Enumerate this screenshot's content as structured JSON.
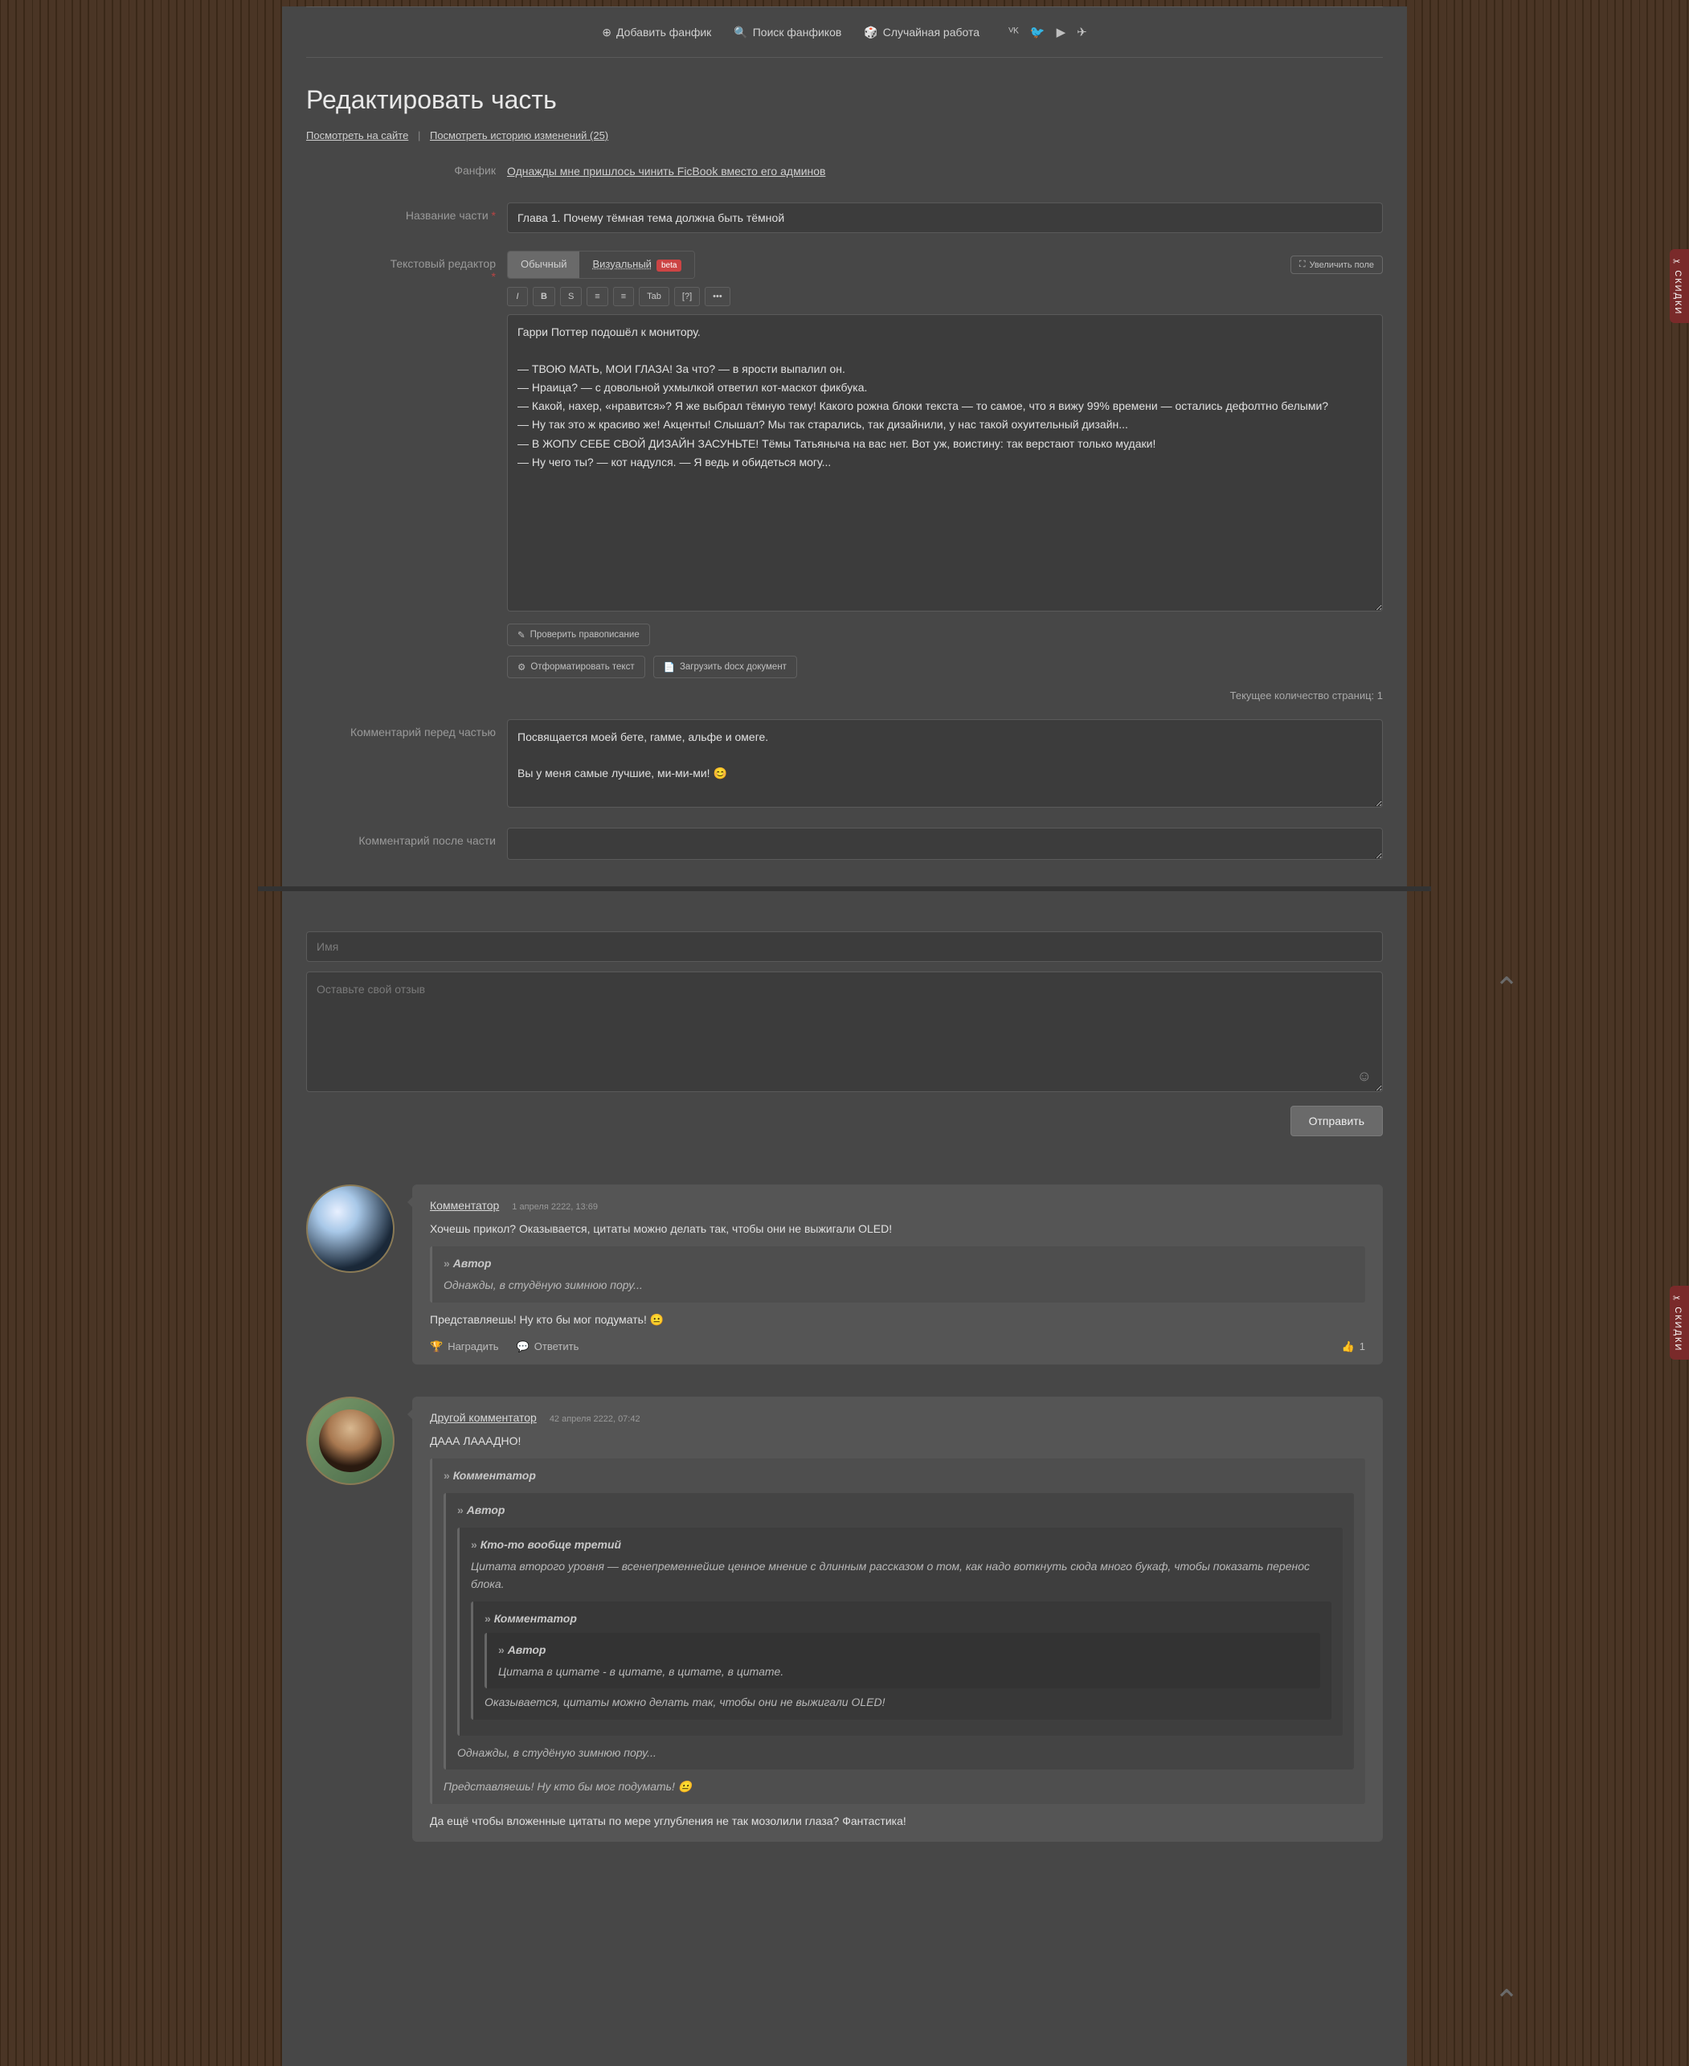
{
  "nav": {
    "add": "Добавить фанфик",
    "search": "Поиск фанфиков",
    "random": "Случайная работа"
  },
  "page_title": "Редактировать часть",
  "sub": {
    "view": "Посмотреть на сайте",
    "history": "Посмотреть историю изменений (25)"
  },
  "labels": {
    "fanfic": "Фанфик",
    "chapter_title": "Название части",
    "editor": "Текстовый редактор",
    "comment_before": "Комментарий перед частью",
    "comment_after": "Комментарий после части"
  },
  "fanfic_link": "Однажды мне пришлось чинить FicBook вместо его админов",
  "chapter_title_value": "Глава 1. Почему тёмная тема должна быть тёмной",
  "editor_tabs": {
    "plain": "Обычный",
    "visual": "Визуальный",
    "beta": "beta"
  },
  "expand": "Увеличить поле",
  "toolbar": {
    "i": "I",
    "b": "B",
    "s": "S",
    "al": "≡",
    "ac": "≡",
    "tab": "Tab",
    "q": "[?]",
    "more": "•••"
  },
  "editor_text": "Гарри Поттер подошёл к монитору.\n\n— ТВОЮ МАТЬ, МОИ ГЛАЗА! За что? — в ярости выпалил он.\n— Нраица? — с довольной ухмылкой ответил кот-маскот фикбука.\n— Какой, нахер, «нравится»? Я же выбрал тёмную тему! Какого рожна блоки текста — то самое, что я вижу 99% времени — остались дефолтно белыми?\n— Ну так это ж красиво же! Акценты! Слышал? Мы так старались, так дизайнили, у нас такой охуительный дизайн...\n— В ЖОПУ СЕБЕ СВОЙ ДИЗАЙН ЗАСУНЬТЕ! Тёмы Татьяныча на вас нет. Вот уж, воистину: так верстают только мудаки!\n— Ну чего ты? — кот надулся. — Я ведь и обидеться могу...",
  "under": {
    "spell": "Проверить правописание",
    "format": "Отформатировать текст",
    "docx": "Загрузить docx документ"
  },
  "pagecount": "Текущее количество страниц: 1",
  "comment_before_value": "Посвящается моей бете, гамме, альфе и омеге.\n\nВы у меня самые лучшие, ми-ми-ми! 😊",
  "comment_after_value": "",
  "review": {
    "name_ph": "Имя",
    "text_ph": "Оставьте свой отзыв",
    "send": "Отправить"
  },
  "c1": {
    "name": "Комментатор",
    "date": "1 апреля 2222, 13:69",
    "line1": "Хочешь прикол? Оказывается, цитаты можно делать так, чтобы они не выжигали OLED!",
    "q_author": "Автор",
    "q_text": "Однажды, в студёную зимнюю пору...",
    "line2": "Представляешь! Ну кто бы мог подумать! 😐",
    "reward": "Наградить",
    "reply": "Ответить",
    "likes": "1"
  },
  "c2": {
    "name": "Другой комментатор",
    "date": "42 апреля 2222, 07:42",
    "line1": "ДААА ЛАААДНО!",
    "q1_author": "Комментатор",
    "q2_author": "Автор",
    "q3_author": "Кто-то вообще третий",
    "q3_text": "Цитата второго уровня — всенепременнейше ценное мнение с длинным рассказом о том, как надо воткнуть сюда много букаф, чтобы показать перенос блока.",
    "q4_author": "Комментатор",
    "q5_author": "Автор",
    "q5_text": "Цитата в цитате - в цитате, в цитате, в цитате.",
    "q4_tail": "Оказывается, цитаты можно делать так, чтобы они не выжигали OLED!",
    "q2_tail": "Однажды, в студёную зимнюю пору...",
    "q1_tail": "Представляешь! Ну кто бы мог подумать! 😐",
    "line2": "Да ещё чтобы вложенные цитаты по мере углубления не так мозолили глаза? Фантастика!"
  },
  "side_tab": "СКИДКИ"
}
